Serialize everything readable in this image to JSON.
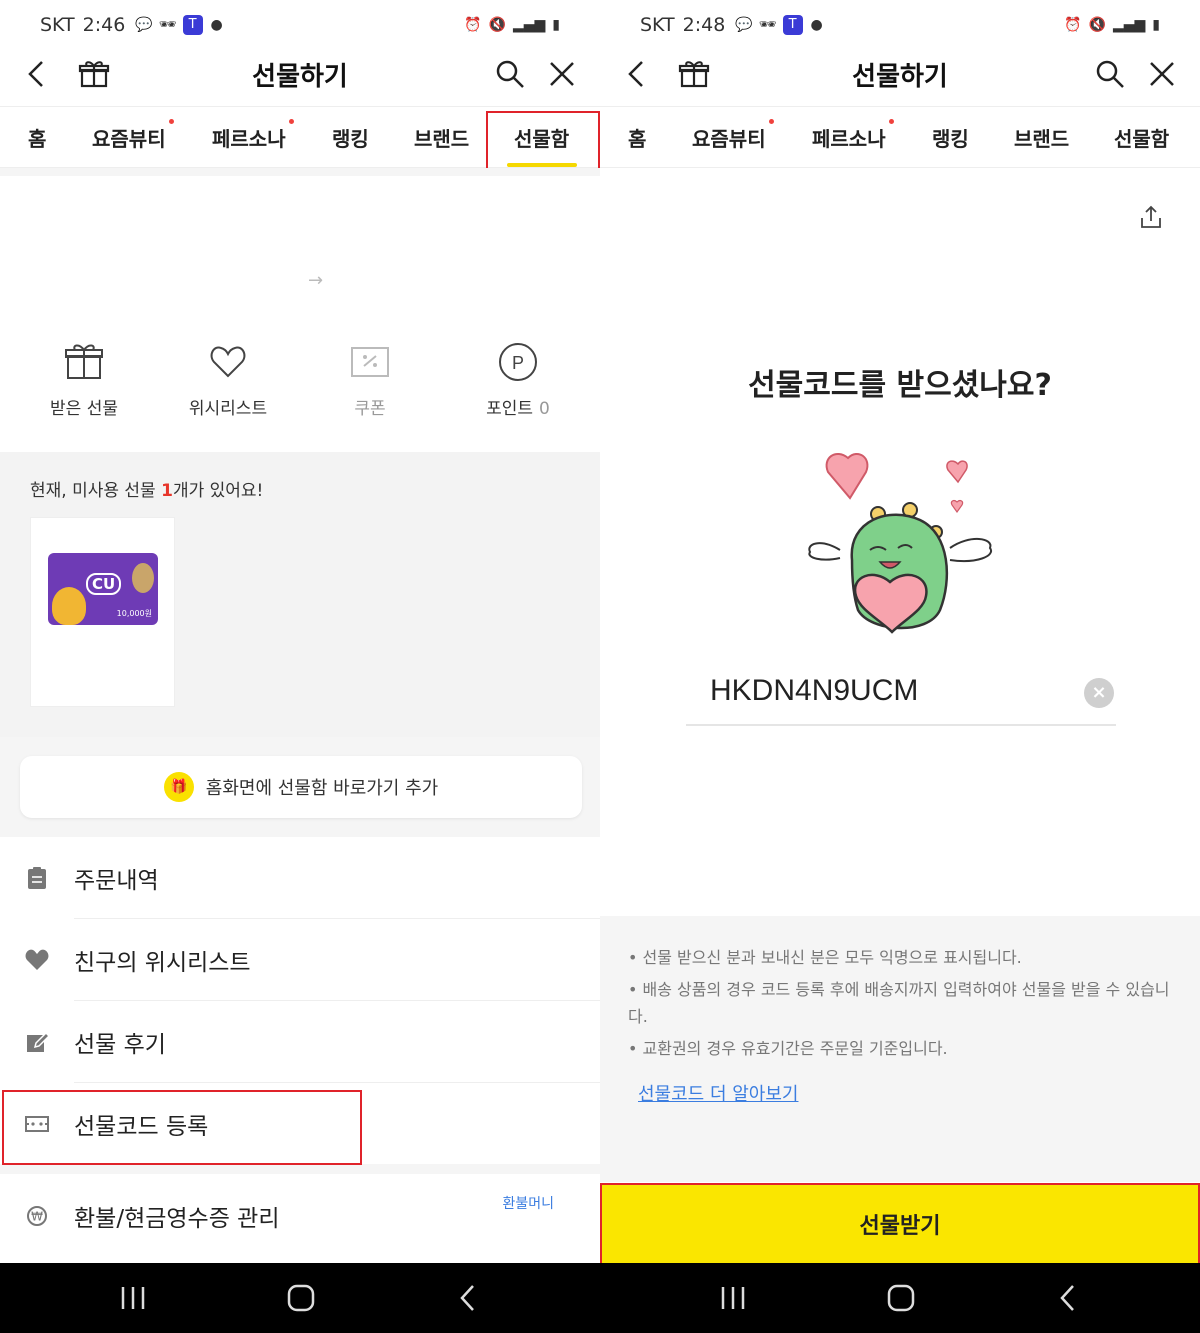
{
  "left": {
    "status": {
      "carrier": "SKT",
      "time": "2:46"
    },
    "header": {
      "title": "선물하기"
    },
    "tabs": [
      {
        "label": "홈",
        "dot": false
      },
      {
        "label": "요즘뷰티",
        "dot": true
      },
      {
        "label": "페르소나",
        "dot": true
      },
      {
        "label": "랭킹",
        "dot": false
      },
      {
        "label": "브랜드",
        "dot": false
      },
      {
        "label": "선물함",
        "dot": false,
        "active": true
      }
    ],
    "quick": {
      "received": "받은 선물",
      "wishlist": "위시리스트",
      "coupon": "쿠폰",
      "points_label": "포인트",
      "points_value": "0"
    },
    "unused": {
      "prefix": "현재, 미사용 선물 ",
      "count": "1",
      "suffix": "개가 있어요!"
    },
    "card": {
      "brand": "CU",
      "amount": "10,000원"
    },
    "shortcut": "홈화면에 선물함 바로가기 추가",
    "menu": [
      {
        "label": "주문내역",
        "icon": "clipboard-icon"
      },
      {
        "label": "친구의 위시리스트",
        "icon": "heart-icon"
      },
      {
        "label": "선물 후기",
        "icon": "edit-icon"
      },
      {
        "label": "선물코드 등록",
        "icon": "ticket-icon"
      },
      {
        "label": "환불/현금영수증 관리",
        "icon": "won-icon",
        "badge": "환불머니"
      }
    ]
  },
  "right": {
    "status": {
      "carrier": "SKT",
      "time": "2:48"
    },
    "header": {
      "title": "선물하기"
    },
    "tabs": [
      {
        "label": "홈",
        "dot": false
      },
      {
        "label": "요즘뷰티",
        "dot": true
      },
      {
        "label": "페르소나",
        "dot": true
      },
      {
        "label": "랭킹",
        "dot": false
      },
      {
        "label": "브랜드",
        "dot": false
      },
      {
        "label": "선물함",
        "dot": false
      }
    ],
    "question": "선물코드를 받으셨나요?",
    "code_value": "HKDN4N9UCM",
    "notices": [
      "• 선물 받으신 분과 보내신 분은 모두 익명으로 표시됩니다.",
      "• 배송 상품의 경우 코드 등록 후에 배송지까지 입력하여야 선물을 받을 수 있습니다.",
      "• 교환권의 경우 유효기간은 주문일 기준입니다."
    ],
    "learn_more": "선물코드 더 알아보기",
    "receive_button": "선물받기"
  },
  "colors": {
    "accent_yellow": "#fae600",
    "highlight_red": "#e0232a",
    "link_blue": "#3b7de0"
  }
}
